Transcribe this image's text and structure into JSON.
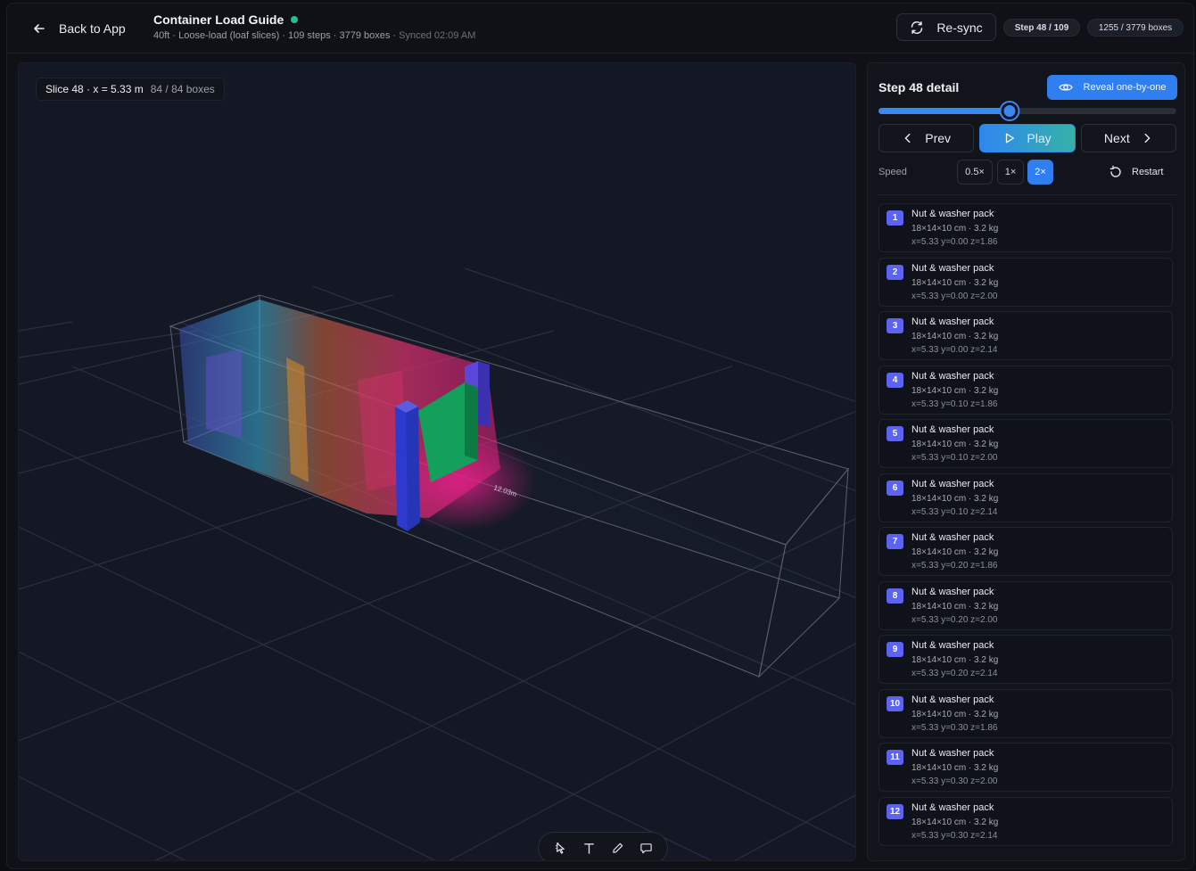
{
  "header": {
    "back_label": "Back to App",
    "title": "Container Load Guide",
    "subtitle": "40ft · Loose-load (loaf slices) · 109 steps · 3779 boxes · ",
    "synced": "Synced 02:09 AM",
    "resync_label": "Re-sync",
    "step_pill": "Step 48 / 109",
    "boxes_pill": "1255 / 3779 boxes",
    "status_color": "#22c08a"
  },
  "viewport": {
    "slice_label": "Slice 48 · x = 5.33 m",
    "slice_count": "84 / 84 boxes",
    "dimension_label": "12.03m",
    "tools": [
      "select-icon",
      "text-icon",
      "pen-icon",
      "comment-icon"
    ]
  },
  "panel": {
    "title": "Step 48 detail",
    "reveal_label": "Reveal one-by-one",
    "progress": {
      "step": 48,
      "total": 109
    },
    "prev_label": "Prev",
    "play_label": "Play",
    "next_label": "Next",
    "speed_label": "Speed",
    "speed_options": [
      "0.5×",
      "1×",
      "2×"
    ],
    "speed_selected": "2×",
    "restart_label": "Restart",
    "accent": "#2f7ff0",
    "items": [
      {
        "n": "1",
        "name": "Nut & washer pack",
        "dims": "18×14×10 cm · 3.2 kg",
        "pos": "x=5.33 y=0.00 z=1.86"
      },
      {
        "n": "2",
        "name": "Nut & washer pack",
        "dims": "18×14×10 cm · 3.2 kg",
        "pos": "x=5.33 y=0.00 z=2.00"
      },
      {
        "n": "3",
        "name": "Nut & washer pack",
        "dims": "18×14×10 cm · 3.2 kg",
        "pos": "x=5.33 y=0.00 z=2.14"
      },
      {
        "n": "4",
        "name": "Nut & washer pack",
        "dims": "18×14×10 cm · 3.2 kg",
        "pos": "x=5.33 y=0.10 z=1.86"
      },
      {
        "n": "5",
        "name": "Nut & washer pack",
        "dims": "18×14×10 cm · 3.2 kg",
        "pos": "x=5.33 y=0.10 z=2.00"
      },
      {
        "n": "6",
        "name": "Nut & washer pack",
        "dims": "18×14×10 cm · 3.2 kg",
        "pos": "x=5.33 y=0.10 z=2.14"
      },
      {
        "n": "7",
        "name": "Nut & washer pack",
        "dims": "18×14×10 cm · 3.2 kg",
        "pos": "x=5.33 y=0.20 z=1.86"
      },
      {
        "n": "8",
        "name": "Nut & washer pack",
        "dims": "18×14×10 cm · 3.2 kg",
        "pos": "x=5.33 y=0.20 z=2.00"
      },
      {
        "n": "9",
        "name": "Nut & washer pack",
        "dims": "18×14×10 cm · 3.2 kg",
        "pos": "x=5.33 y=0.20 z=2.14"
      },
      {
        "n": "10",
        "name": "Nut & washer pack",
        "dims": "18×14×10 cm · 3.2 kg",
        "pos": "x=5.33 y=0.30 z=1.86"
      },
      {
        "n": "11",
        "name": "Nut & washer pack",
        "dims": "18×14×10 cm · 3.2 kg",
        "pos": "x=5.33 y=0.30 z=2.00"
      },
      {
        "n": "12",
        "name": "Nut & washer pack",
        "dims": "18×14×10 cm · 3.2 kg",
        "pos": "x=5.33 y=0.30 z=2.14"
      }
    ]
  }
}
